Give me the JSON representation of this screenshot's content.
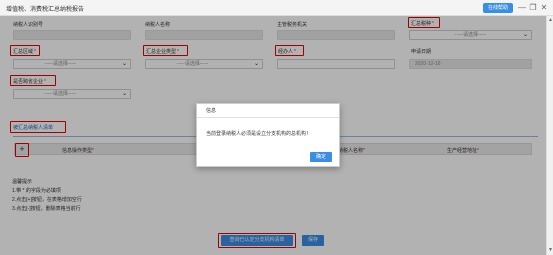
{
  "window": {
    "title": "增值税、消费税汇总纳税报告",
    "online_help_label": "在线帮助",
    "minimize_glyph": "—",
    "restore_glyph": "❐",
    "close_glyph": "✕"
  },
  "form": {
    "taxpayer_id_label": "纳税人识别号",
    "taxpayer_name_label": "纳税人名称",
    "tax_authority_label": "主管税务机关",
    "summary_tax_type_label": "汇总税种",
    "summary_tax_type_value": "-----请选择-----",
    "summary_region_label": "汇总区域",
    "summary_region_value": "-----请选择-----",
    "enterprise_type_label": "汇总企业类型",
    "enterprise_type_value": "-----请选择-----",
    "handler_label": "经办人",
    "apply_date_label": "申请日期",
    "apply_date_value": "2020-12-16",
    "cross_region_label": "是否跨省企业",
    "cross_region_value": "-----请选择-----",
    "required_mark": "*"
  },
  "section": {
    "title": "被汇总纳税人清单"
  },
  "grid": {
    "add_glyph": "+",
    "columns": [
      {
        "label": "信息操作类型"
      },
      {
        "label": "纳税人名称"
      },
      {
        "label": "生产经营地址"
      }
    ]
  },
  "tips": {
    "title": "温馨提示",
    "lines": [
      "1.带 * 的字段为必填项",
      "2.点击[+]按钮，在表格增加空行",
      "3.点击[-]按钮，删除表格当前行"
    ]
  },
  "footer": {
    "query_button_label": "查询已认定分支机构清单",
    "save_button_label": "保存"
  },
  "dialog": {
    "title": "信息",
    "message": "当前登录纳税人必须是设立分支机构的总机构！",
    "ok_label": "确定"
  },
  "colors": {
    "accent": "#3a8ee6",
    "highlight": "#e60000",
    "required": "#e02020"
  }
}
